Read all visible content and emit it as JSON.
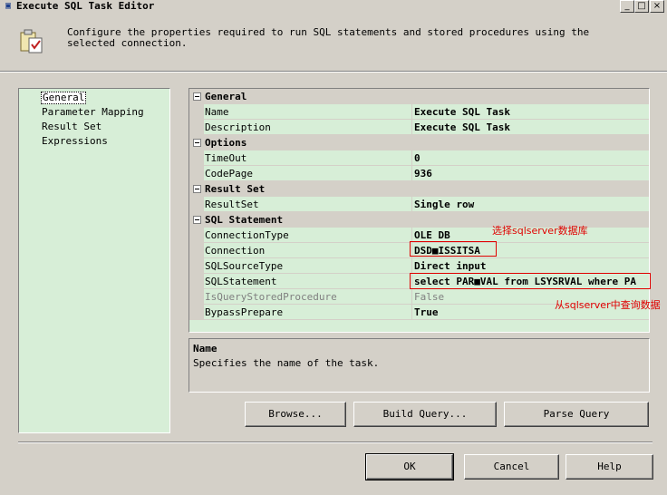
{
  "window": {
    "title": "Execute SQL Task Editor",
    "controls": {
      "minimize": "_",
      "maximize": "□",
      "close": "×"
    }
  },
  "header": {
    "description": "Configure the properties required to run SQL statements and stored procedures using the selected connection.",
    "icon": "task-editor-icon"
  },
  "nav": {
    "items": [
      {
        "label": "General",
        "selected": true
      },
      {
        "label": "Parameter Mapping",
        "selected": false
      },
      {
        "label": "Result Set",
        "selected": false
      },
      {
        "label": "Expressions",
        "selected": false
      }
    ]
  },
  "grid": {
    "categories": [
      {
        "label": "General",
        "rows": [
          {
            "key": "Name",
            "value": "Execute SQL Task"
          },
          {
            "key": "Description",
            "value": "Execute SQL Task"
          }
        ]
      },
      {
        "label": "Options",
        "rows": [
          {
            "key": "TimeOut",
            "value": "0"
          },
          {
            "key": "CodePage",
            "value": "936"
          }
        ]
      },
      {
        "label": "Result Set",
        "rows": [
          {
            "key": "ResultSet",
            "value": "Single row"
          }
        ]
      },
      {
        "label": "SQL Statement",
        "rows": [
          {
            "key": "ConnectionType",
            "value": "OLE DB"
          },
          {
            "key": "Connection",
            "value": "DSD■ISSITSA"
          },
          {
            "key": "SQLSourceType",
            "value": "Direct input"
          },
          {
            "key": "SQLStatement",
            "value": "select PAR■VAL from LSYSRVAL where PA"
          },
          {
            "key": "IsQueryStoredProcedure",
            "value": "False",
            "disabled": true
          },
          {
            "key": "BypassPrepare",
            "value": "True"
          }
        ]
      }
    ]
  },
  "annotations": {
    "connection_note": "选择sqlserver数据库",
    "statement_note": "从sqlserver中查询数据",
    "color": "#e00000"
  },
  "help": {
    "title": "Name",
    "description": "Specifies the name of the task."
  },
  "buttons": {
    "browse": "Browse...",
    "build_query": "Build Query...",
    "parse_query": "Parse Query",
    "ok": "OK",
    "cancel": "Cancel",
    "help": "Help"
  },
  "colors": {
    "panel_bg": "#d7eed7",
    "chrome": "#d4d0c8"
  }
}
